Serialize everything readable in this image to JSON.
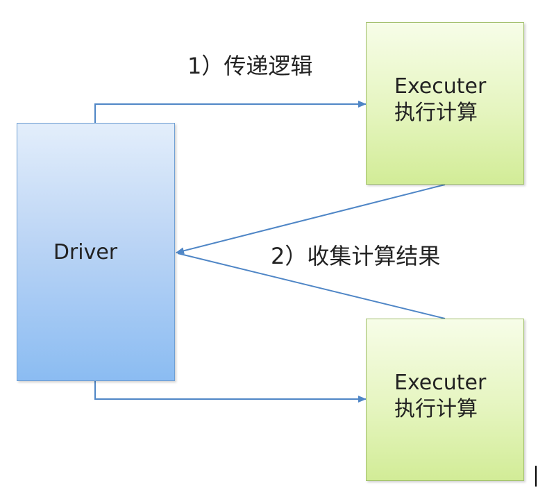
{
  "diagram": {
    "driver": {
      "label": "Driver"
    },
    "executors": [
      {
        "title": "Executer",
        "subtitle": "执行计算"
      },
      {
        "title": "Executer",
        "subtitle": "执行计算"
      }
    ],
    "edges": [
      {
        "label": "1）传递逻辑"
      },
      {
        "label": "2）收集计算结果"
      }
    ]
  }
}
